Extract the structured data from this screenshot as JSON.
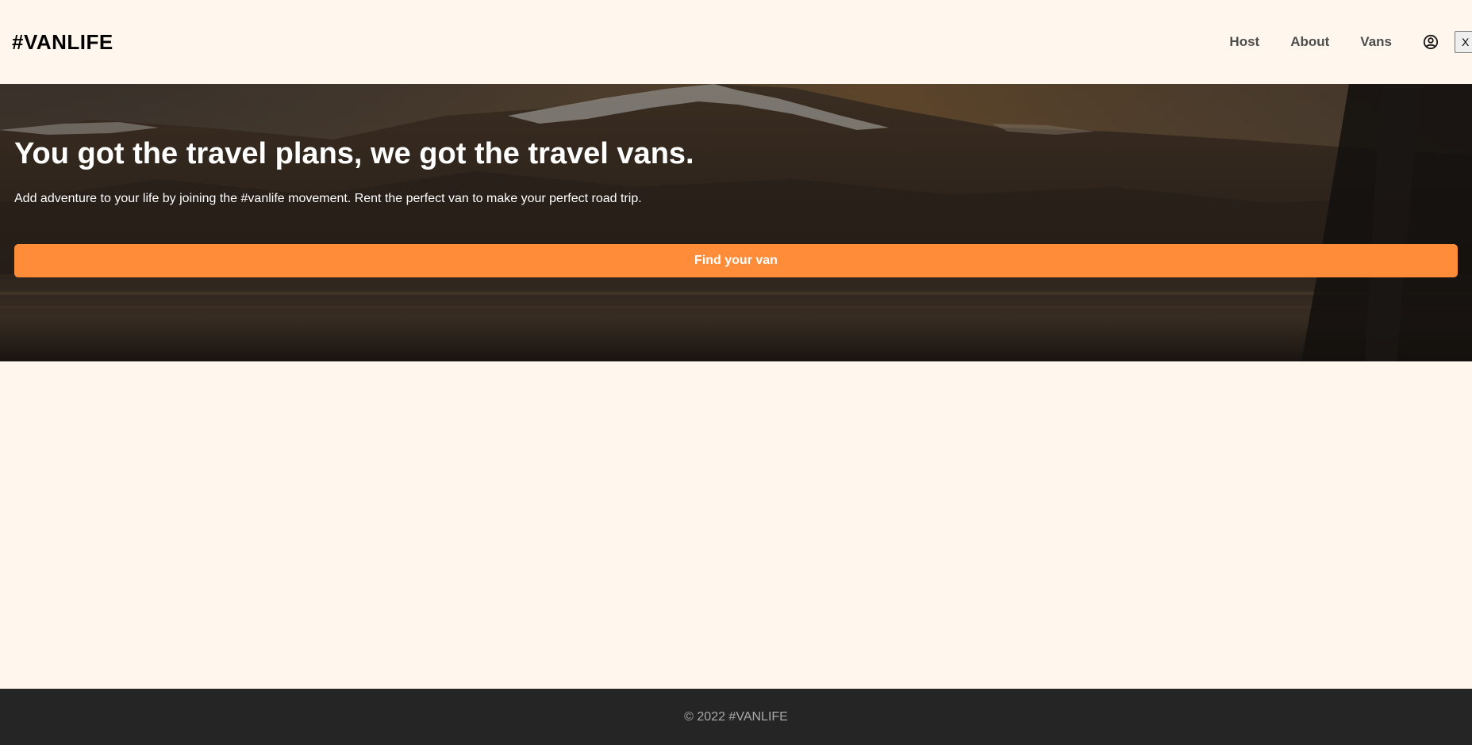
{
  "header": {
    "logo": "#VANLIFE",
    "nav": {
      "host": "Host",
      "about": "About",
      "vans": "Vans",
      "login_icon": "user-circle-icon",
      "logout_label": "X"
    }
  },
  "hero": {
    "title": "You got the travel plans, we got the travel vans.",
    "subtitle": "Add adventure to your life by joining the #vanlife movement. Rent the perfect van to make your perfect road trip.",
    "button_label": "Find your van",
    "button_color": "#FF8C38"
  },
  "footer": {
    "text": "© 2022 #VANLIFE"
  },
  "colors": {
    "background": "#FFF7ED",
    "footer_bg": "#252525",
    "nav_text": "#4D4D4D"
  }
}
